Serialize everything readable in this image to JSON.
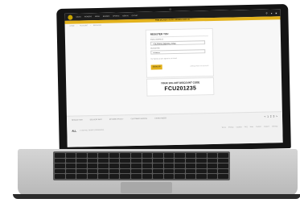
{
  "site": {
    "nav_links": [
      "SALES",
      "WOMENS",
      "MENS",
      "BRANDS",
      "SPORTS",
      "NEW IN",
      "OUTLET"
    ],
    "promo_text": "FREE DELIVERY ON ALL ORDERS OVER £50",
    "breadcrumbs": [
      "HOME",
      "ACCOUNT",
      "REGISTER"
    ]
  },
  "register": {
    "title": "REGISTER YOU",
    "email_label": "EMAIL ADDRESS",
    "email_value": "YOURMAIL@EMAIL.COM",
    "password_label": "PASSWORD",
    "password_value": "••••••••••",
    "note": "By signing up you agree to our terms",
    "submit_label": "SIGN UP",
    "aside_note": "Already have an account?"
  },
  "discount": {
    "title": "YOUR 10% OFF DISCOUNT CODE",
    "code": "FCU201235"
  },
  "footer": {
    "links": [
      "NEWSLETTER",
      "DELIVERY INFO",
      "RETURNS POLICY",
      "CUSTOMER SERVICE",
      "STORE FINDER"
    ],
    "pager": [
      "<",
      "1",
      "2",
      "3",
      ">"
    ],
    "logo": "ALL",
    "copyright": "© 2024 ALL RIGHTS RESERVED",
    "legal_links": [
      "Terms",
      "Privacy",
      "Cookies",
      "FAQ",
      "Help",
      "Contact",
      "Careers",
      "Sitemap"
    ]
  },
  "colors": {
    "accent": "#e3b21c",
    "nav": "#1d1d1d"
  }
}
